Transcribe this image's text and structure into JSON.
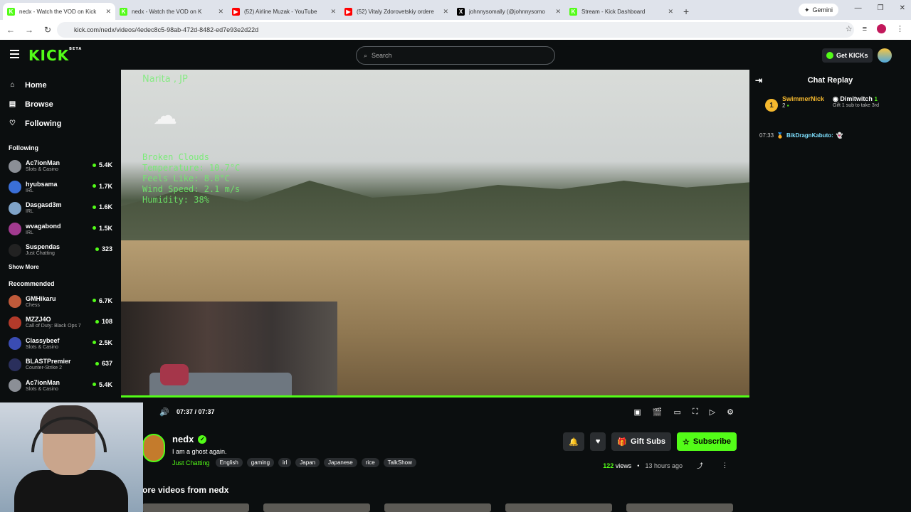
{
  "browser": {
    "tabs": [
      {
        "title": "nedx - Watch the VOD on Kick",
        "color": "#53fc18",
        "glyph": "K",
        "active": true
      },
      {
        "title": "nedx - Watch the VOD on K",
        "color": "#53fc18",
        "glyph": "K"
      },
      {
        "title": "(52) Airline Muzak - YouTube",
        "color": "#ff0000",
        "glyph": "▶"
      },
      {
        "title": "(52) Vitaly Zdorovetskiy ordere",
        "color": "#ff0000",
        "glyph": "▶"
      },
      {
        "title": "johnnysomally (@johnnysomo",
        "color": "#000000",
        "glyph": "X"
      },
      {
        "title": "Stream - Kick Dashboard",
        "color": "#53fc18",
        "glyph": "K"
      }
    ],
    "gemini": "Gemini",
    "url": "kick.com/nedx/videos/4edec8c5-98ab-472d-8482-ed7e93e2d22d"
  },
  "header": {
    "logo": "KICK",
    "logo_sup": "BETA",
    "search_placeholder": "Search",
    "get_kicks": "Get KICKs"
  },
  "sidebar": {
    "nav": [
      {
        "label": "Home",
        "icon": "⌂"
      },
      {
        "label": "Browse",
        "icon": "▤"
      },
      {
        "label": "Following",
        "icon": "♡"
      }
    ],
    "following_title": "Following",
    "following": [
      {
        "name": "Ac7ionMan",
        "category": "Slots & Casino",
        "viewers": "5.4K",
        "color": "#8b8f96"
      },
      {
        "name": "hyubsama",
        "category": "IRL",
        "viewers": "1.7K",
        "color": "#3a6fd8"
      },
      {
        "name": "Dasgasd3m",
        "category": "IRL",
        "viewers": "1.6K",
        "color": "#7fa3c8"
      },
      {
        "name": "wvagabond",
        "category": "IRL",
        "viewers": "1.5K",
        "color": "#a13a8f"
      },
      {
        "name": "Suspendas",
        "category": "Just Chatting",
        "viewers": "323",
        "color": "#222222"
      }
    ],
    "show_more": "Show More",
    "recommended_title": "Recommended",
    "recommended": [
      {
        "name": "GMHikaru",
        "category": "Chess",
        "viewers": "6.7K",
        "color": "#c05a3a"
      },
      {
        "name": "MZZJ4O",
        "category": "Call of Duty: Black Ops 7",
        "viewers": "108",
        "color": "#b33a2a"
      },
      {
        "name": "Classybeef",
        "category": "Slots & Casino",
        "viewers": "2.5K",
        "color": "#3a4cb3"
      },
      {
        "name": "BLASTPremier",
        "category": "Counter-Strike 2",
        "viewers": "637",
        "color": "#2a2f5c"
      },
      {
        "name": "Ac7ionMan",
        "category": "Slots & Casino",
        "viewers": "5.4K",
        "color": "#8b8f96"
      }
    ]
  },
  "video": {
    "weather_location": "Narita , JP",
    "weather_lines": [
      "Broken Clouds",
      "Temperature: 10.7°C",
      "Feels Like: 8.8°C",
      "Wind Speed: 2.1 m/s",
      "Humidity: 38%"
    ],
    "time": "07:37 / 07:37",
    "progress": 1.0
  },
  "chat": {
    "title": "Chat Replay",
    "pin1": {
      "rank": "1",
      "name": "SwimmerNick",
      "count": "2"
    },
    "pin2": {
      "name": "Dimitwitch",
      "count": "1",
      "caption": "Gift 1 sub to take 3rd"
    },
    "messages": [
      {
        "time": "07:33",
        "user": "BikDragnKabuto:",
        "text": "👻"
      }
    ]
  },
  "channel": {
    "name": "nedx",
    "title": "I am a ghost again.",
    "category": "Just Chatting",
    "tags": [
      "English",
      "gaming",
      "irl",
      "Japan",
      "Japanese",
      "rice",
      "TalkShow"
    ],
    "gift_label": "Gift Subs",
    "subscribe_label": "Subscribe",
    "views": "122",
    "views_label": "views",
    "separator": "•",
    "ago": "13 hours ago",
    "more_videos": "ore videos from nedx"
  }
}
